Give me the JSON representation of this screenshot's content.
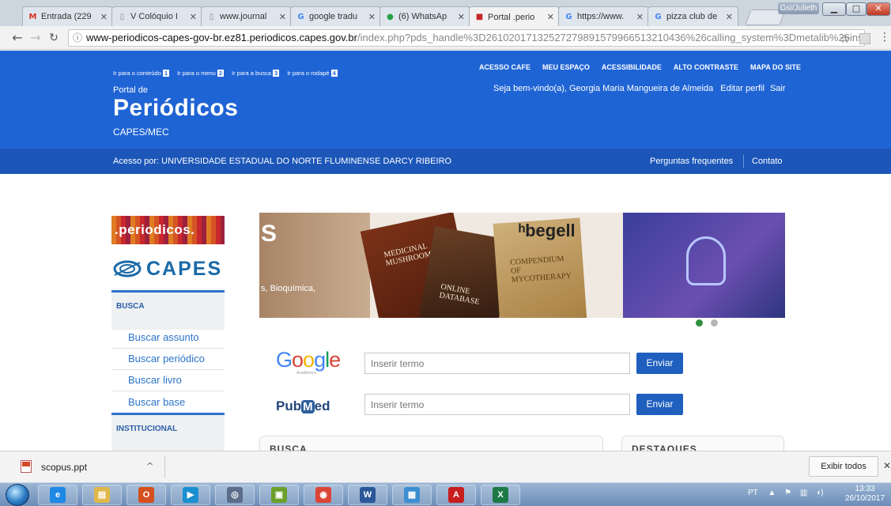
{
  "browser": {
    "tabs": [
      {
        "title": "Entrada (229",
        "icon": "gmail-icon",
        "color": "#d93025",
        "glyph": "M"
      },
      {
        "title": "V Colóquio I",
        "icon": "page-icon",
        "color": "#888888",
        "glyph": "▯"
      },
      {
        "title": "www.journal",
        "icon": "page-icon",
        "color": "#888888",
        "glyph": "▯"
      },
      {
        "title": "google tradu",
        "icon": "google-icon",
        "color": "#4285f4",
        "glyph": "G"
      },
      {
        "title": "(6) WhatsAp",
        "icon": "whatsapp-icon",
        "color": "#25a244",
        "glyph": "●"
      },
      {
        "title": "Portal .perio",
        "icon": "portal-icon",
        "color": "#c62828",
        "glyph": "■"
      },
      {
        "title": "https://www.",
        "icon": "google-icon",
        "color": "#4285f4",
        "glyph": "G"
      },
      {
        "title": "pizza club de",
        "icon": "google-icon",
        "color": "#4285f4",
        "glyph": "G"
      }
    ],
    "active_tab": 5,
    "user_name": "Gsi/Julieth",
    "url_host": "www-periodicos-capes-gov-br.ez81.periodicos.capes.gov.br",
    "url_path": "/index.php?pds_handle%3D26102017132527279891579966513210436%26calling_system%3Dmetalib%26instit..."
  },
  "header": {
    "skip_links": [
      {
        "label": "Ir para o conteúdo",
        "key": "1"
      },
      {
        "label": "Ir para o menu",
        "key": "2"
      },
      {
        "label": "Ir para a busca",
        "key": "3"
      },
      {
        "label": "Ir para o rodapé",
        "key": "4"
      }
    ],
    "top_links": [
      "ACESSO CAFE",
      "MEU ESPAÇO",
      "ACESSIBILIDADE",
      "ALTO CONTRASTE",
      "MAPA DO SITE"
    ],
    "portal_de": "Portal de",
    "brand": "Periódicos",
    "capes_mec": "CAPES/MEC",
    "welcome": "Seja bem-vindo(a),  Georgia Maria Mangueira de Almeida",
    "edit_profile": "Editar perfil",
    "logout": "Sair",
    "access": "Acesso por: UNIVERSIDADE ESTADUAL DO NORTE FLUMINENSE DARCY RIBEIRO",
    "faq": "Perguntas frequentes",
    "contact": "Contato",
    "color": "#1f64d5"
  },
  "sidebar": {
    "logo_periodicos": ".periodicos.",
    "logo_capes": "CAPES",
    "busca_heading": "BUSCA",
    "items": [
      "Buscar assunto",
      "Buscar periódico",
      "Buscar livro",
      "Buscar base"
    ],
    "institucional_heading": "INSTITUCIONAL"
  },
  "banner": {
    "left_text": "S",
    "sub_text": "s, Bioquímica,",
    "book1": "Medicinal Mushrooms",
    "book2": "Online Database",
    "book3": "Compendium of Mycotherapy",
    "publisher": "begell",
    "slides": 2,
    "active_slide": 0
  },
  "search": {
    "google_logo": "Google",
    "google_sub": "Acadêmico",
    "google_placeholder": "Inserir termo",
    "pubmed_logo_a": "Pub",
    "pubmed_logo_m": "M",
    "pubmed_logo_b": "ed",
    "pubmed_placeholder": "Inserir termo",
    "send": "Enviar"
  },
  "panels": {
    "busca": "BUSCA",
    "destaques": "DESTAQUES"
  },
  "downloads": {
    "file": "scopus.ppt",
    "show_all": "Exibir todos"
  },
  "taskbar": {
    "apps": [
      {
        "icon": "ie-icon",
        "color": "#1e88e5",
        "glyph": "e"
      },
      {
        "icon": "explorer-icon",
        "color": "#e0b84a",
        "glyph": "▤"
      },
      {
        "icon": "office-icon",
        "color": "#d5501f",
        "glyph": "O"
      },
      {
        "icon": "media-player-icon",
        "color": "#1a8fd1",
        "glyph": "▶"
      },
      {
        "icon": "network-icon",
        "color": "#5b6d8a",
        "glyph": "◎"
      },
      {
        "icon": "sticky-notes-icon",
        "color": "#6a9f2a",
        "glyph": "▣"
      },
      {
        "icon": "chrome-icon",
        "color": "#db4437",
        "glyph": "◉"
      },
      {
        "icon": "word-icon",
        "color": "#2b579a",
        "glyph": "W"
      },
      {
        "icon": "photos-icon",
        "color": "#3c8fd1",
        "glyph": "▦"
      },
      {
        "icon": "acrobat-icon",
        "color": "#c81e1e",
        "glyph": "A"
      },
      {
        "icon": "excel-icon",
        "color": "#1d7a45",
        "glyph": "X"
      }
    ],
    "lang": "PT",
    "time": "13:33",
    "date": "26/10/2017"
  }
}
